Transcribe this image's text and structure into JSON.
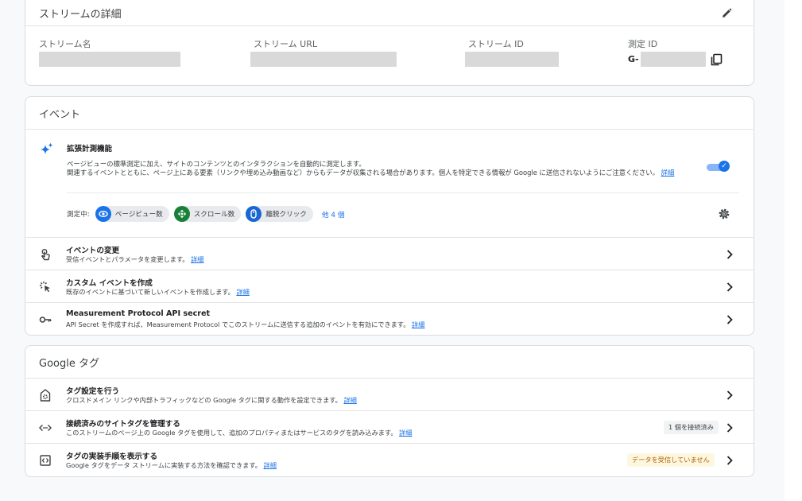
{
  "stream_details": {
    "title": "ストリームの詳細",
    "fields": {
      "name_label": "ストリーム名",
      "url_label": "ストリーム URL",
      "id_label": "ストリーム ID",
      "measurement_id_label": "測定 ID",
      "measurement_id_prefix": "G-"
    }
  },
  "events": {
    "title": "イベント",
    "enhanced": {
      "title": "拡張計測機能",
      "desc_line1": "ページビューの標準測定に加え、サイトのコンテンツとのインタラクションを自動的に測定します。",
      "desc_line2": "関連するイベントとともに、ページ上にある要素（リンクや埋め込み動画など）からもデータが収集される場合があります。個人を特定できる情報が Google に送信されないようにご注意ください。",
      "desc_link": "詳細",
      "toggle_on": true,
      "measuring_label": "測定中:",
      "chips": [
        "ページビュー数",
        "スクロール数",
        "離脱クリック"
      ],
      "more": "他 4 個"
    },
    "rows": [
      {
        "title": "イベントの変更",
        "desc": "受信イベントとパラメータを変更します。",
        "link": "詳細"
      },
      {
        "title": "カスタム イベントを作成",
        "desc": "既存のイベントに基づいて新しいイベントを作成します。",
        "link": "詳細"
      },
      {
        "title": "Measurement Protocol API secret",
        "desc": "API Secret を作成すれば、Measurement Protocol でこのストリームに送信する追加のイベントを有効にできます。",
        "link": "詳細"
      }
    ]
  },
  "google_tag": {
    "title": "Google タグ",
    "rows": [
      {
        "title": "タグ設定を行う",
        "desc": "クロスドメイン リンクや内部トラフィックなどの Google タグに関する動作を設定できます。",
        "link": "詳細"
      },
      {
        "title": "接続済みのサイトタグを管理する",
        "desc": "このストリームのページ上の Google タグを使用して、追加のプロパティまたはサービスのタグを読み込みます。",
        "link": "詳細",
        "badge": "1 個を接続済み"
      },
      {
        "title": "タグの実装手順を表示する",
        "desc": "Google タグをデータ ストリームに実装する方法を確認できます。",
        "link": "詳細",
        "badge": "データを受信していません"
      }
    ]
  },
  "colors": {
    "accent": "#1a73e8",
    "page_bg": "#f8f9fa",
    "warning_text": "#b06000",
    "warning_bg": "#fef7e0",
    "chip_pageview": "#1a73e8",
    "chip_scroll": "#188038",
    "chip_outbound": "#1967d2"
  }
}
